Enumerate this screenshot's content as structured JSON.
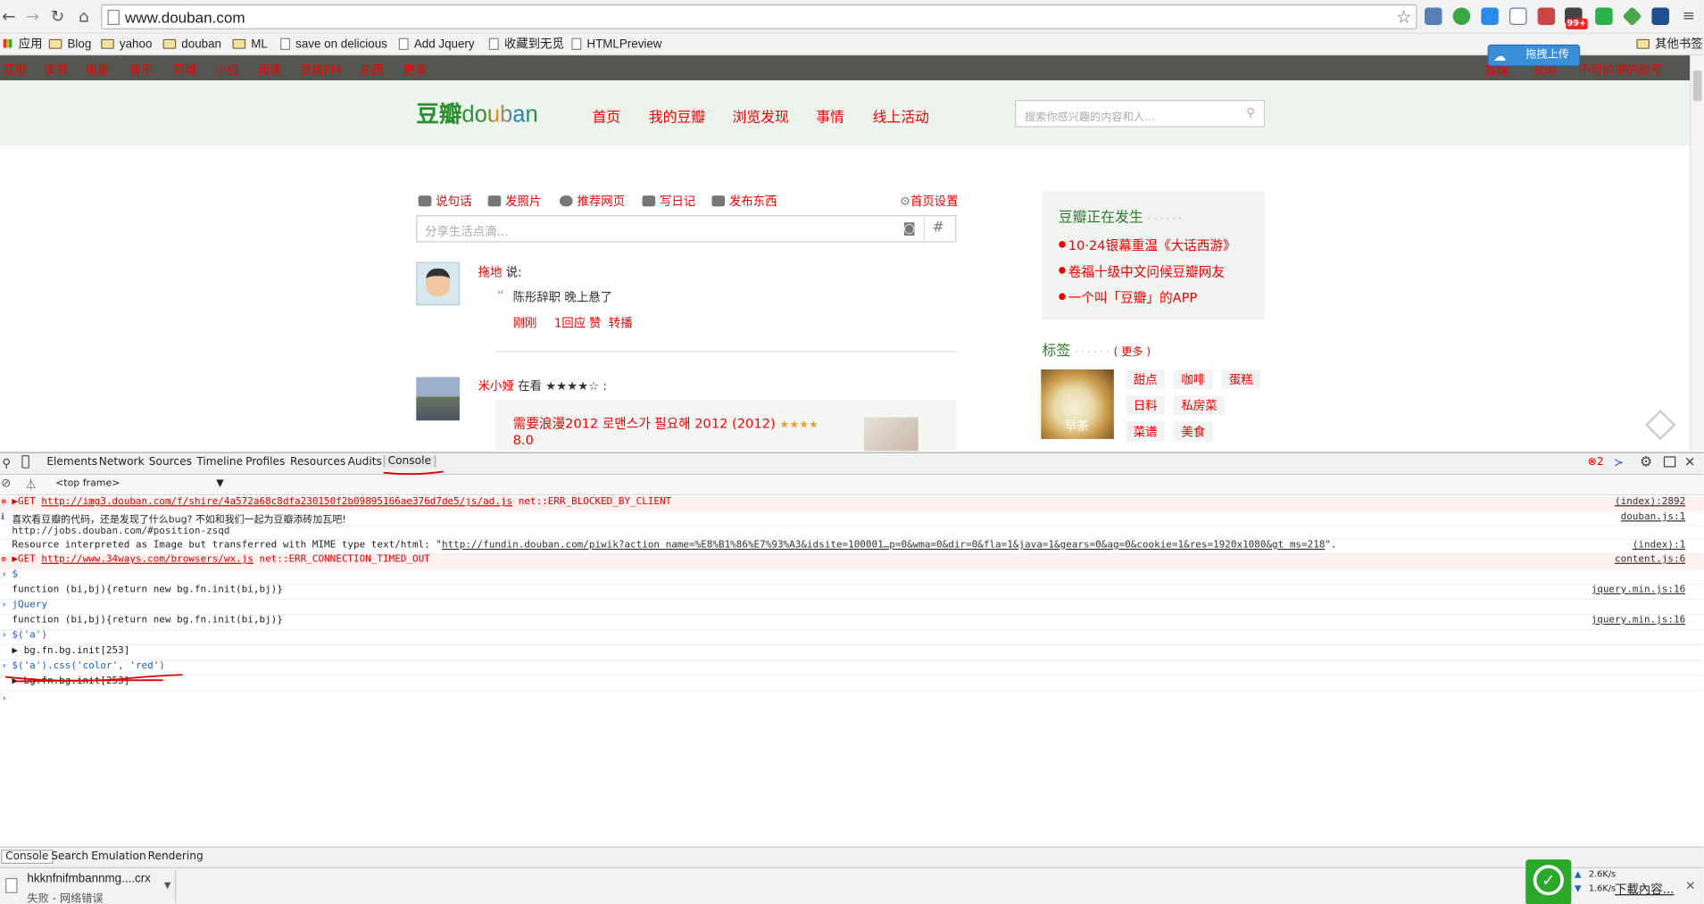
{
  "browser": {
    "url": "www.douban.com",
    "bookmarks": [
      {
        "label": "应用",
        "kind": "apps"
      },
      {
        "label": "Blog",
        "kind": "folder"
      },
      {
        "label": "yahoo",
        "kind": "folder"
      },
      {
        "label": "douban",
        "kind": "folder"
      },
      {
        "label": "ML",
        "kind": "folder"
      },
      {
        "label": "save on delicious",
        "kind": "page"
      },
      {
        "label": "Add Jquery",
        "kind": "page"
      },
      {
        "label": "收藏到无觅",
        "kind": "page"
      },
      {
        "label": "HTMLPreview",
        "kind": "page"
      }
    ],
    "other_bookmarks": "其他书签",
    "ext_badge": "99+",
    "upload_tip": "拖拽上传"
  },
  "douban": {
    "topnav": [
      "豆瓣",
      "读书",
      "电影",
      "音乐",
      "同城",
      "小组",
      "阅读",
      "豆瓣FM",
      "东西",
      "更多"
    ],
    "topnav_right": [
      "提醒",
      "豆邮",
      "不可的懒的账号"
    ],
    "logo_cn": "豆瓣",
    "logo_en": "douban",
    "nav": [
      "首页",
      "我的豆瓣",
      "浏览发现",
      "事情",
      "线上活动"
    ],
    "search_placeholder": "搜索你感兴趣的内容和人...",
    "actions": [
      "说句话",
      "发照片",
      "推荐网页",
      "写日记",
      "发布东西"
    ],
    "home_settings": "首页设置",
    "share_placeholder": "分享生活点滴...",
    "status1": {
      "user": "拖地",
      "said": "说:",
      "quote": "陈彤辞职 晚上悬了",
      "time": "刚刚",
      "reply": "1回应",
      "like": "赞",
      "reshare": "转播"
    },
    "status2": {
      "user": "米小娅",
      "action": "在看 ★★★★☆ :",
      "title": "需要浪漫2012 로맨스가 필요해 2012 (2012)",
      "stars": "★★★★",
      "score": "8.0"
    },
    "side_title": "豆瓣正在发生",
    "side_dots": "· · · · · ·",
    "side_items": [
      "10·24银幕重温《大话西游》",
      "卷福十级中文问候豆瓣网友",
      "一个叫「豆瓣」的APP"
    ],
    "tags_title": "标签",
    "tags_dots": "· · · · · ·",
    "tags_more": "( 更多 )",
    "tags": [
      "甜点",
      "咖啡",
      "蛋糕",
      "日料",
      "私房菜",
      "菜谱",
      "美食"
    ],
    "tag_img_label": "早茶"
  },
  "devtools": {
    "tabs": [
      "Elements",
      "Network",
      "Sources",
      "Timeline",
      "Profiles",
      "Resources",
      "Audits",
      "Console"
    ],
    "error_count": "2",
    "frame": "<top frame>",
    "lines": [
      {
        "prefix": "▶GET",
        "url": "http://img3.douban.com/f/shire/4a572a68c8dfa230150f2b09895166ae376d7de5/js/ad.js",
        "tail": "net::ERR_BLOCKED_BY_CLIENT",
        "src": "(index):2892"
      },
      {
        "text": "喜欢看豆瓣的代码，还是发现了什么bug? 不如和我们一起为豆瓣添砖加瓦吧!",
        "src": "douban.js:1"
      },
      {
        "text": "http://jobs.douban.com/#position-zsqd"
      },
      {
        "prefix": "Resource interpreted as Image but transferred with MIME type text/html: \"",
        "url": "http://fundin.douban.com/piwik?action_name=%E8%B1%86%E7%93%A3&idsite=100001…p=0&wma=0&dir=0&fla=1&java=1&gears=0&ag=0&cookie=1&res=1920x1080&gt_ms=218",
        "tail": "\".",
        "src": "(index):1"
      },
      {
        "prefix": "▶GET",
        "url": "http://www.34ways.com/browsers/wx.js",
        "tail": "net::ERR_CONNECTION_TIMED_OUT",
        "src": "content.js:6"
      },
      {
        "text": "$"
      },
      {
        "text": "function (bi,bj){return new bg.fn.init(bi,bj)}",
        "src": "jquery.min.js:16"
      },
      {
        "text": "jQuery"
      },
      {
        "text": "function (bi,bj){return new bg.fn.init(bi,bj)}",
        "src": "jquery.min.js:16"
      },
      {
        "text": "$('a')"
      },
      {
        "text": "▶ bg.fn.bg.init[253]"
      },
      {
        "text": "$('a').css('color', 'red')"
      },
      {
        "text": "▶ bg.fn.bg.init[253]"
      },
      {
        "text": ""
      }
    ],
    "drawer_tabs": [
      "Console",
      "Search",
      "Emulation",
      "Rendering"
    ]
  },
  "download": {
    "file": "hkknfnifmbannmg....crx",
    "status": "失败 - 网络错误",
    "speed_up": "2.6K/s",
    "speed_down": "1.6K/s",
    "link": "下載內容..."
  }
}
